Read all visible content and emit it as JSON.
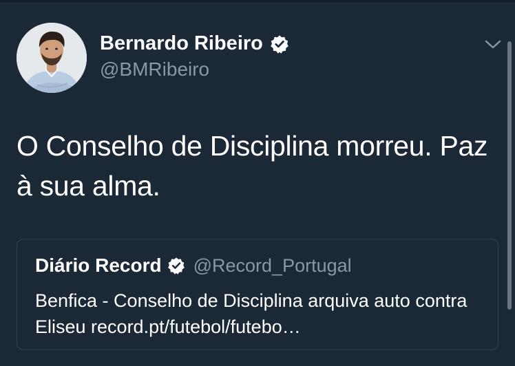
{
  "author": {
    "display_name": "Bernardo Ribeiro",
    "handle": "@BMRibeiro",
    "verified": true,
    "avatar_icon": "profile-photo"
  },
  "tweet": {
    "text": "O Conselho de Disciplina morreu. Paz à sua alma."
  },
  "quoted_tweet": {
    "display_name": "Diário Record",
    "handle": "@Record_Portugal",
    "verified": true,
    "text": "Benfica - Conselho de Disciplina arquiva auto contra Eliseu record.pt/futebol/futebo…"
  },
  "icons": {
    "verified": "verified-badge-icon",
    "menu": "chevron-down-icon"
  },
  "colors": {
    "background": "#1b2836",
    "secondary_text": "#8899a6",
    "border": "#38444d",
    "primary_text": "#ffffff"
  }
}
